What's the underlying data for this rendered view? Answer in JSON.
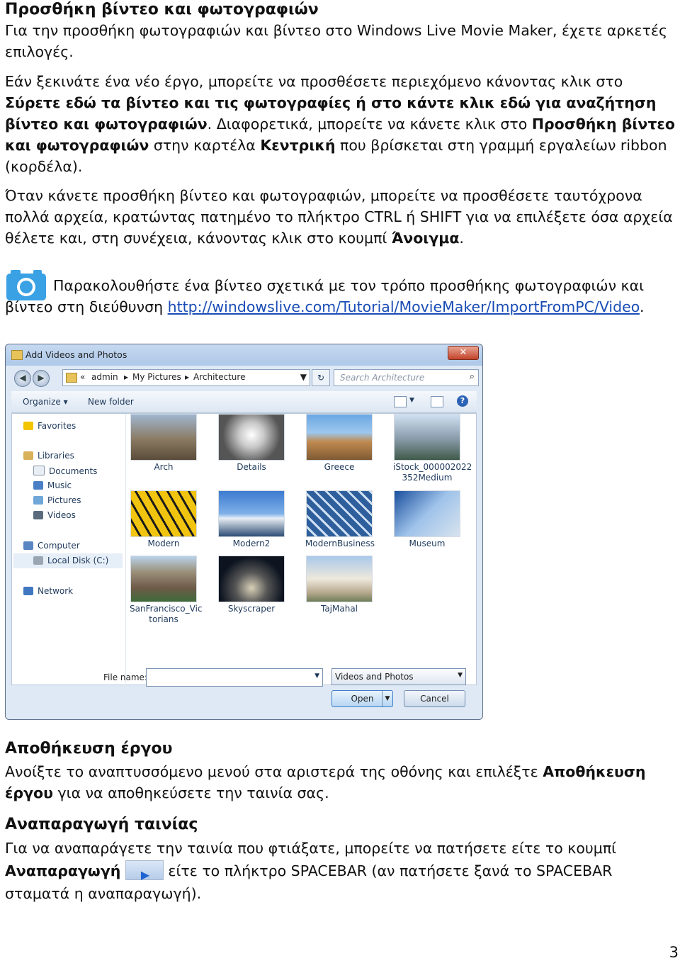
{
  "section1": {
    "heading": "Προσθήκη βίντεο και φωτογραφιών",
    "p1": "Για την προσθήκη φωτογραφιών και βίντεο στο Windows Live Movie Maker, έχετε αρκετές επιλογές.",
    "p2_a": "Εάν ξεκινάτε ένα νέο έργο, μπορείτε να προσθέσετε περιεχόμενο κάνοντας κλικ στο ",
    "p2_b": "Σύρετε εδώ τα βίντεο και τις φωτογραφίες ή στο κάντε κλικ εδώ για αναζήτηση βίντεο και φωτογραφιών",
    "p2_c": ". Διαφορετικά, μπορείτε να κάνετε κλικ στο ",
    "p2_d": "Προσθήκη βίντεο και φωτογραφιών",
    "p2_e": " στην καρτέλα ",
    "p2_f": "Κεντρική",
    "p2_g": " που βρίσκεται στη γραμμή εργαλείων ribbon (κορδέλα).",
    "p3_a": "Όταν κάνετε προσθήκη βίντεο και φωτογραφιών, μπορείτε να προσθέσετε ταυτόχρονα πολλά αρχεία, κρατώντας πατημένο το πλήκτρο CTRL ή SHIFT για να επιλέξετε όσα αρχεία θέλετε και, στη συνέχεια, κάνοντας κλικ στο κουμπί ",
    "p3_b": "Άνοιγμα",
    "p3_c": ".",
    "video_a": "Παρακολουθήστε ένα βίντεο σχετικά με τον τρόπο προσθήκης φωτογραφιών και βίντεο στη διεύθυνση ",
    "video_link": "http://windowslive.com/Tutorial/MovieMaker/ImportFromPC/Video",
    "video_c": "."
  },
  "dialog": {
    "title": "Add Videos and Photos",
    "close": "✕",
    "breadcrumb": [
      "«",
      "admin",
      "▸",
      "My Pictures",
      "▸",
      "Architecture"
    ],
    "search_placeholder": "Search Architecture",
    "organize": "Organize ▾",
    "new_folder": "New folder",
    "nav": [
      "Favorites",
      "Libraries",
      "Documents",
      "Music",
      "Pictures",
      "Videos",
      "Computer",
      "Local Disk (C:)",
      "Network"
    ],
    "thumbs": [
      "Arch",
      "Details",
      "Greece",
      "iStock_000002022 352Medium",
      "Modern",
      "Modern2",
      "ModernBusiness",
      "Museum",
      "SanFrancisco_Vic torians",
      "Skyscraper",
      "TajMahal"
    ],
    "file_name_label": "File name:",
    "file_type": "Videos and Photos",
    "open": "Open",
    "cancel": "Cancel"
  },
  "section2": {
    "heading": "Αποθήκευση έργου",
    "p_a": "Ανοίξτε το αναπτυσσόμενο μενού στα αριστερά της οθόνης και επιλέξτε ",
    "p_b": "Αποθήκευση έργου",
    "p_c": " για να αποθηκεύσετε την ταινία σας."
  },
  "section3": {
    "heading": "Αναπαραγωγή ταινίας",
    "p_a": "Για να αναπαράγετε την ταινία που φτιάξατε, μπορείτε να πατήσετε είτε το κουμπί ",
    "p_b": "Αναπαραγωγή",
    "p_c": " είτε το πλήκτρο SPACEBAR (αν πατήσετε ξανά το SPACEBAR σταματά η αναπαραγωγή)."
  },
  "page_number": "3"
}
